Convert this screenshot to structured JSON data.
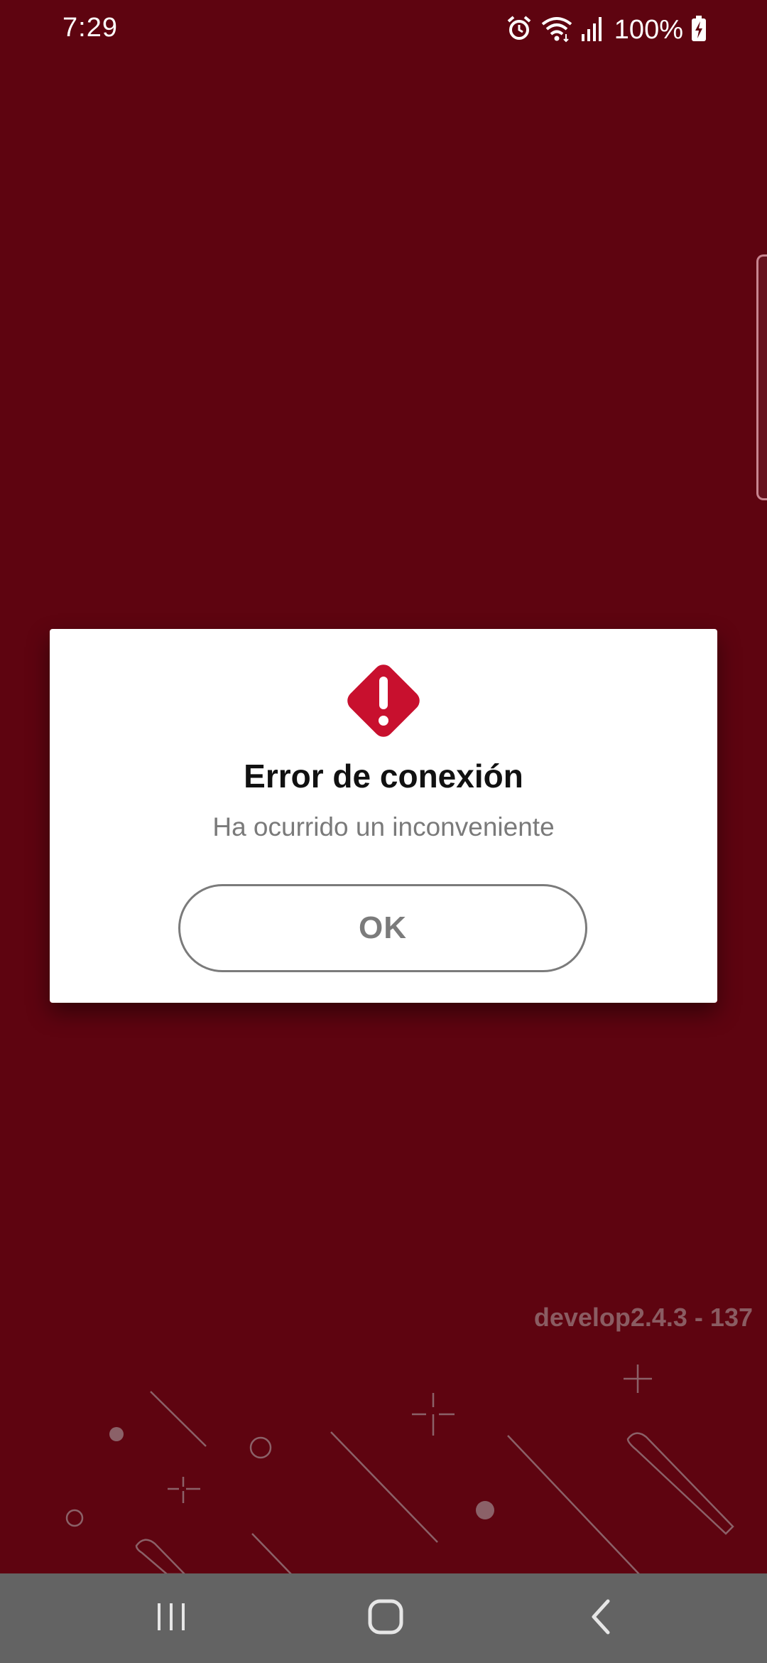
{
  "status_bar": {
    "time": "7:29",
    "battery": "100%",
    "icons": [
      "alarm-icon",
      "wifi-icon",
      "signal-icon",
      "battery-charging-icon"
    ]
  },
  "dialog": {
    "icon": "error-diamond-icon",
    "title": "Error de conexión",
    "message": "Ha ocurrido un inconveniente",
    "ok_label": "OK"
  },
  "footer": {
    "version": "develop2.4.3 - 137"
  },
  "nav_bar": {
    "buttons": [
      "recent-apps-icon",
      "home-icon",
      "back-icon"
    ]
  },
  "colors": {
    "background": "#5e0410",
    "accent": "#c8102e",
    "dialog": "#ffffff",
    "nav_bar": "#636363"
  }
}
